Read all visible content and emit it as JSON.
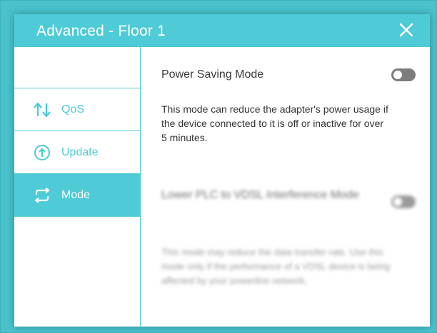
{
  "dialog": {
    "title": "Advanced - Floor 1"
  },
  "sidebar": {
    "items": [
      {
        "label": "QoS",
        "icon": "qos-arrows-icon",
        "active": false
      },
      {
        "label": "Update",
        "icon": "update-circle-icon",
        "active": false
      },
      {
        "label": "Mode",
        "icon": "mode-cycle-icon",
        "active": true
      }
    ]
  },
  "settings": [
    {
      "title": "Power Saving Mode",
      "description": "This mode can reduce the adapter's power usage if the device connected to it is off or inactive for over 5 minutes.",
      "enabled": false
    },
    {
      "title": "Lower PLC to VDSL Interference Mode",
      "description": "This mode may reduce the data transfer rate. Use this mode only if the performance of a VDSL device is being affected by your powerline network.",
      "enabled": false,
      "blurred": true
    }
  ],
  "colors": {
    "accent": "#4ecbd6",
    "background": "#49c2cc",
    "toggle_off": "#7d7d7d"
  }
}
